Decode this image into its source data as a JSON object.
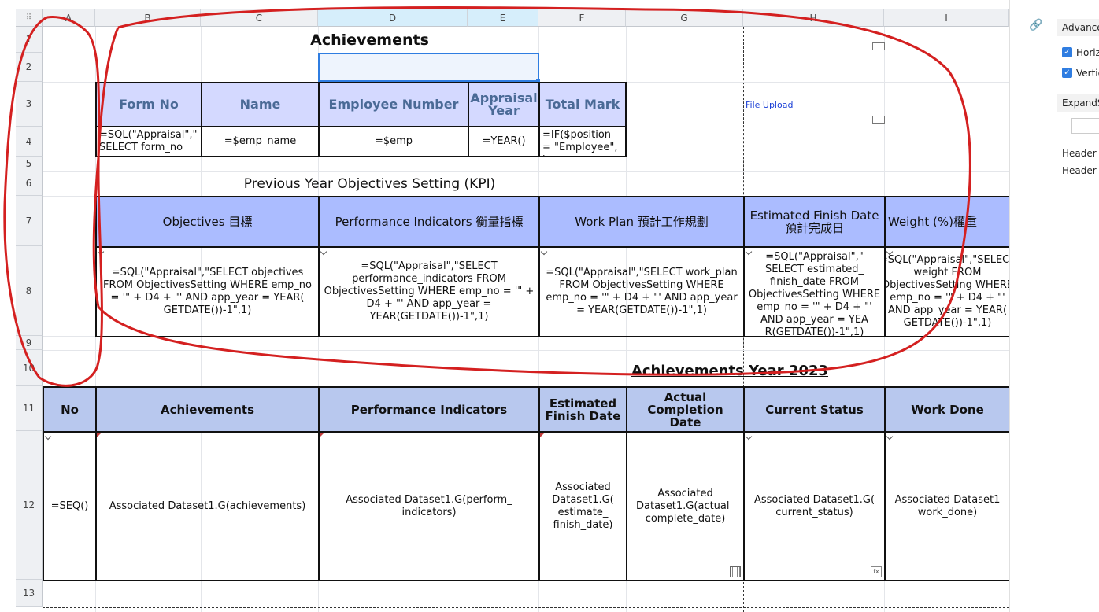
{
  "columns": [
    {
      "letter": "A"
    },
    {
      "letter": "B"
    },
    {
      "letter": "C"
    },
    {
      "letter": "D"
    },
    {
      "letter": "E"
    },
    {
      "letter": "F"
    },
    {
      "letter": "G"
    },
    {
      "letter": "H"
    },
    {
      "letter": "I"
    }
  ],
  "rows": [
    "1",
    "2",
    "3",
    "4",
    "5",
    "6",
    "7",
    "8",
    "9",
    "10",
    "11",
    "12",
    "13"
  ],
  "corner_icon": "grid-dots-icon",
  "sheet": {
    "achievements_title": "Achievements",
    "file_upload_link": "File Upload",
    "header_row": {
      "form_no": "Form No",
      "name": "Name",
      "employee_number": "Employee Number",
      "appraisal_year": "Appraisal Year",
      "total_mark": "Total Mark"
    },
    "value_row": {
      "form_no": "=SQL(\"Appraisal\",\" SELECT form_no",
      "name": "=$emp_name",
      "employee_number": "=$emp",
      "appraisal_year": "=YEAR()",
      "total_mark": "=IF($position = \"Employee\", '"
    },
    "kpi_title": "Previous Year Objectives Setting (KPI)",
    "kpi_headers": {
      "objectives": "Objectives 目標",
      "performance_indicators": "Performance Indicators 衡量指標",
      "work_plan": "Work Plan 預計工作規劃",
      "estimated_finish": "Estimated Finish Date 預計完成日",
      "weight": "Weight (%)權重"
    },
    "kpi_values": {
      "objectives": "=SQL(\"Appraisal\",\"SELECT objectives FROM ObjectivesSetting WHERE emp_no = '\" + D4 + \"' AND app_year = YEAR( GETDATE())-1\",1)",
      "performance_indicators": "=SQL(\"Appraisal\",\"SELECT performance_indicators FROM ObjectivesSetting WHERE emp_no = '\" + D4 + \"' AND app_year = YEAR(GETDATE())-1\",1)",
      "work_plan": "=SQL(\"Appraisal\",\"SELECT work_plan FROM ObjectivesSetting WHERE emp_no = '\" + D4 + \"' AND app_year = YEAR(GETDATE())-1\",1)",
      "estimated_finish": "=SQL(\"Appraisal\",\" SELECT estimated_ finish_date FROM ObjectivesSetting WHERE emp_no = '\" + D4 + \"' AND app_year = YEA R(GETDATE())-1\",1)",
      "weight": "=SQL(\"Appraisal\",\"SELECT weight FROM ObjectivesSetting WHERE emp_no = '\" + D4 + \"' AND app_year = YEAR( GETDATE())-1\",1)"
    },
    "achievements_year_title": "Achievements Year 2023",
    "ach_headers": {
      "no": "No",
      "achievements": "Achievements",
      "performance_indicators": "Performance Indicators",
      "estimated_finish": "Estimated Finish Date",
      "actual_completion": "Actual Completion Date",
      "current_status": "Current Status",
      "work_done": "Work Done"
    },
    "ach_values": {
      "no": "=SEQ()",
      "achievements": "Associated Dataset1.G(achievements)",
      "performance_indicators": "Associated Dataset1.G(perform_ indicators)",
      "estimated_finish": "Associated Dataset1.G( estimate_ finish_date)",
      "actual_completion": "Associated Dataset1.G(actual_ complete_date)",
      "current_status": "Associated Dataset1.G( current_status)",
      "work_done": "Associated Dataset1 work_done)"
    }
  },
  "sidebar": {
    "advanced_label": "Advanced",
    "horizontal_label": "Horiz",
    "vertical_label": "Vertic",
    "expand_label": "ExpandS",
    "header_a_label": "Header A",
    "header_s_label": "Header S"
  },
  "annotation": {
    "color": "#d42020"
  },
  "colors": {
    "header_light": "#d4d9ff",
    "header_blue": "#abbcff",
    "header_steel": "#b8c8ee",
    "selection": "#2f7de1"
  }
}
